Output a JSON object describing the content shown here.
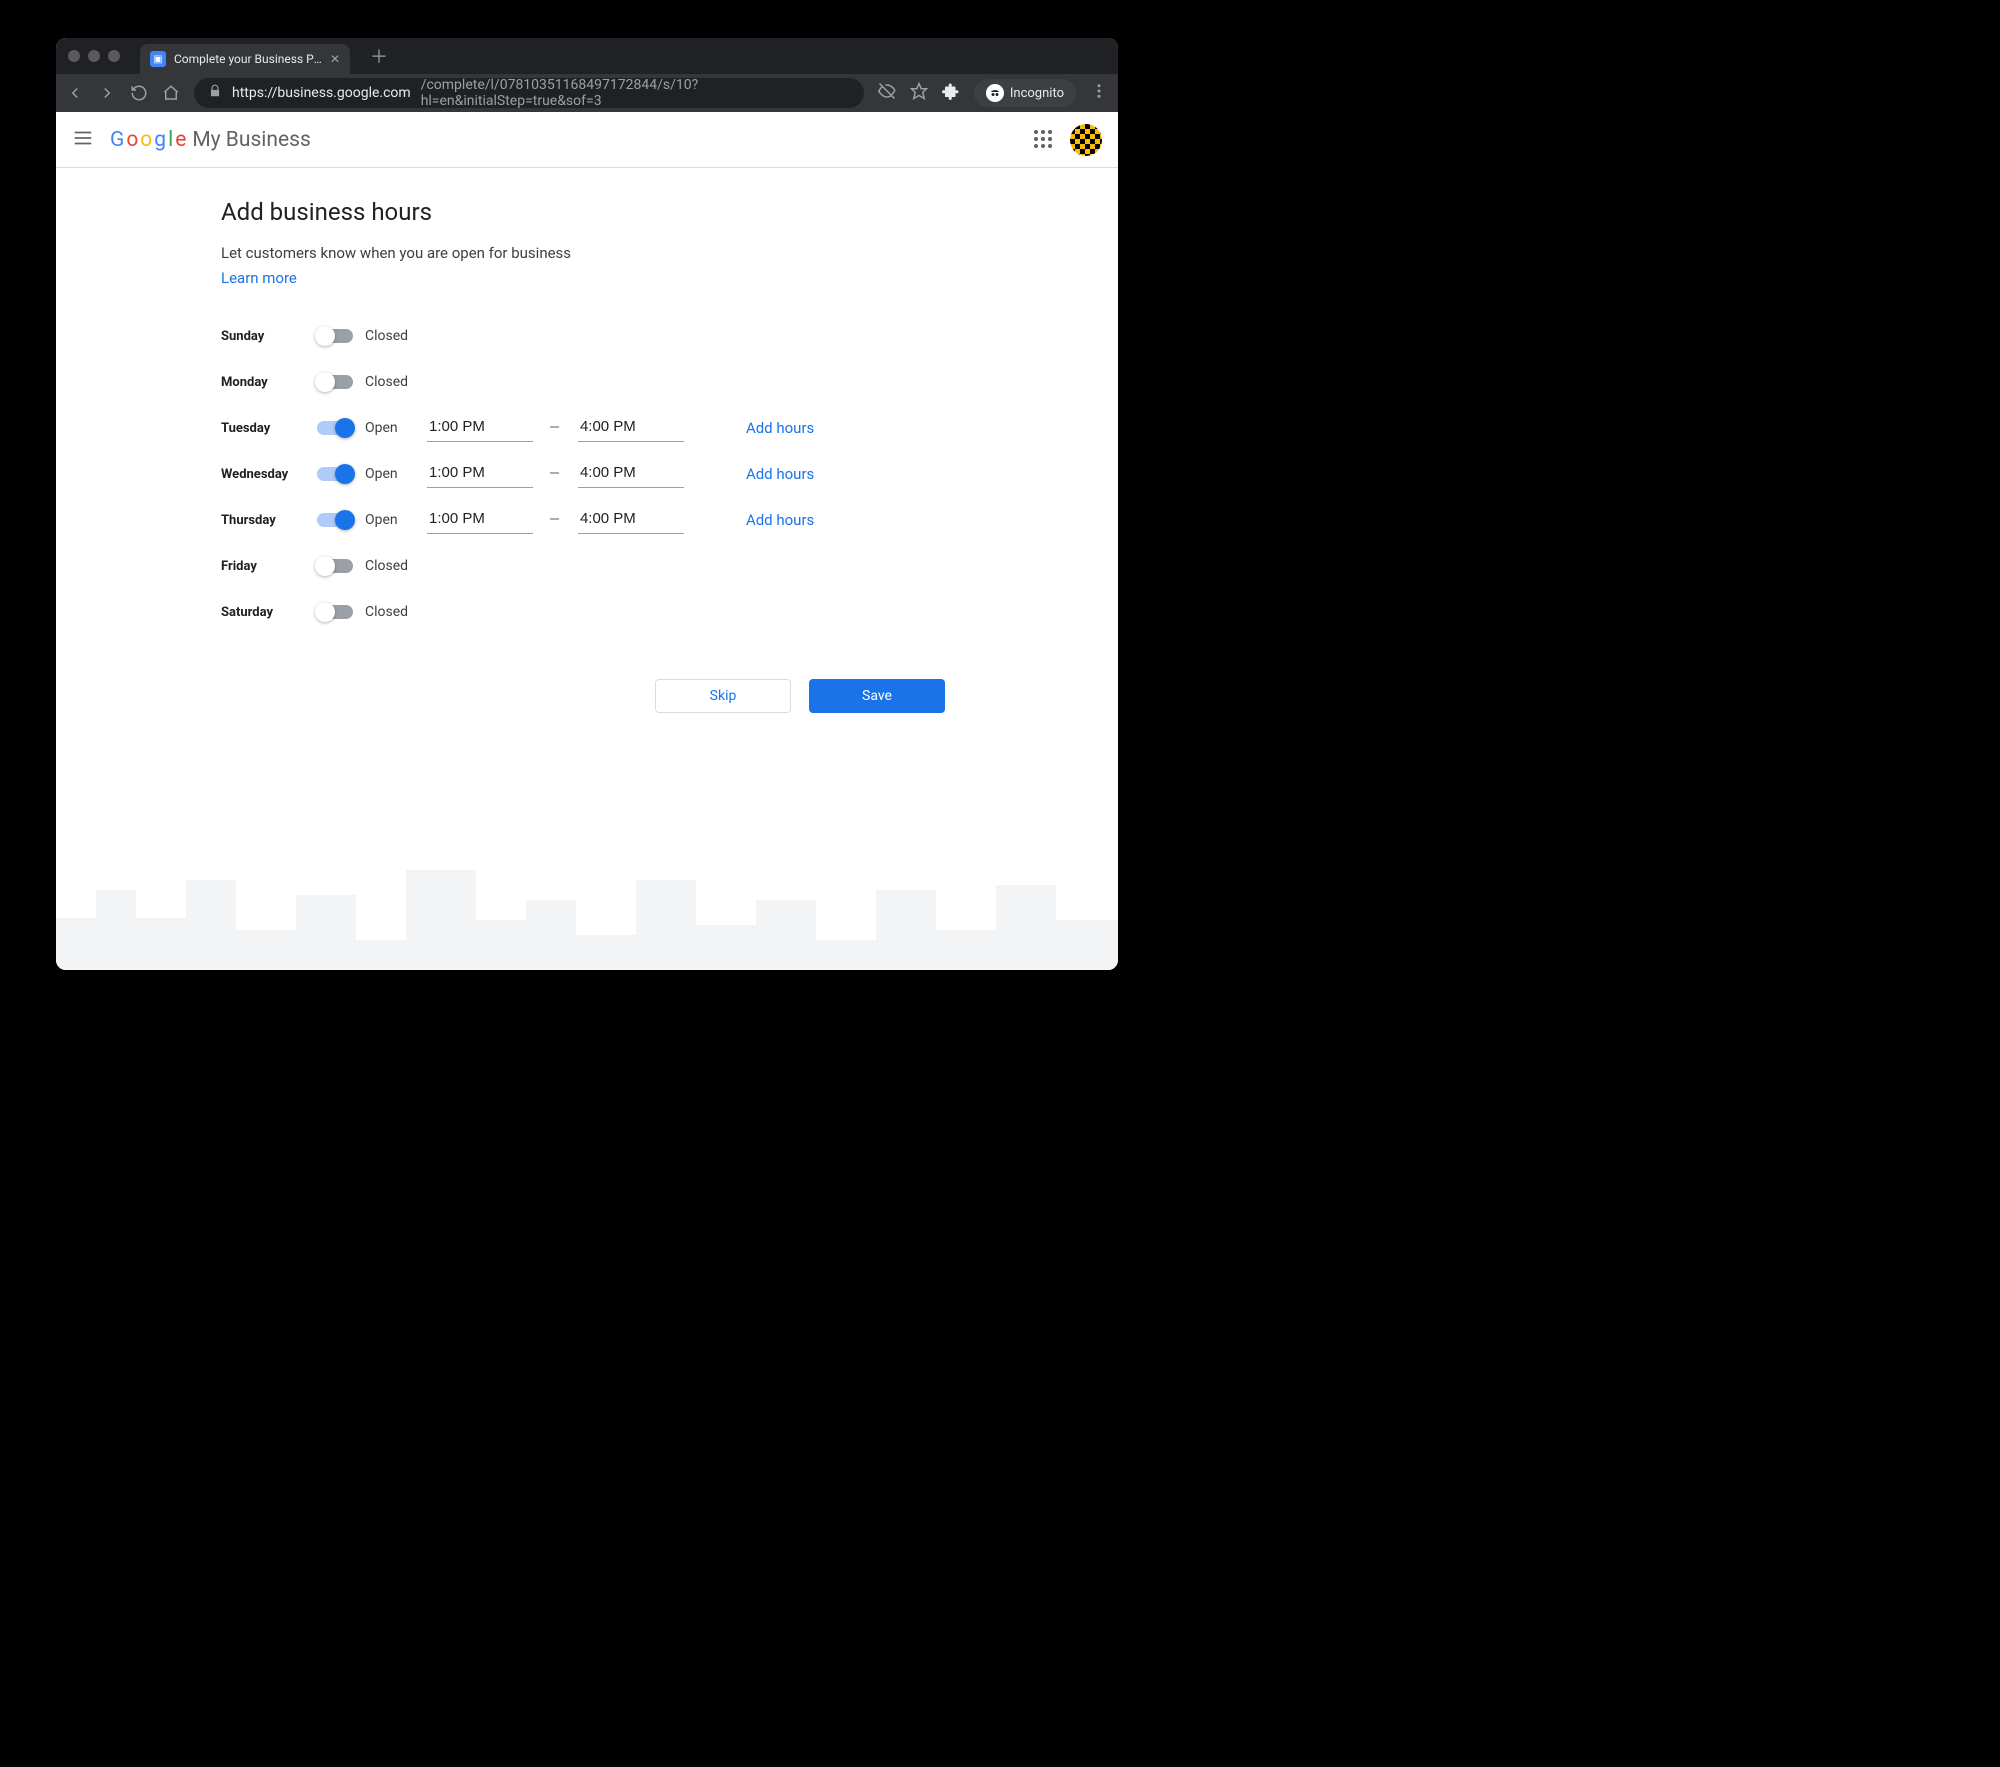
{
  "browser": {
    "tab_title": "Complete your Business Profile",
    "url_secure_host": "https://business.google.com",
    "url_path": "/complete/l/07810351168497172844/s/10?hl=en&initialStep=true&sof=3",
    "incognito_label": "Incognito"
  },
  "header": {
    "product_suffix": "My Business"
  },
  "page": {
    "title": "Add business hours",
    "subtitle": "Let customers know when you are open for business",
    "learn_more": "Learn more",
    "status_open": "Open",
    "status_closed": "Closed",
    "add_hours_label": "Add hours",
    "skip_label": "Skip",
    "save_label": "Save"
  },
  "days": [
    {
      "name": "Sunday",
      "open": false
    },
    {
      "name": "Monday",
      "open": false
    },
    {
      "name": "Tuesday",
      "open": true,
      "from": "1:00 PM",
      "to": "4:00 PM"
    },
    {
      "name": "Wednesday",
      "open": true,
      "from": "1:00 PM",
      "to": "4:00 PM"
    },
    {
      "name": "Thursday",
      "open": true,
      "from": "1:00 PM",
      "to": "4:00 PM"
    },
    {
      "name": "Friday",
      "open": false
    },
    {
      "name": "Saturday",
      "open": false
    }
  ]
}
